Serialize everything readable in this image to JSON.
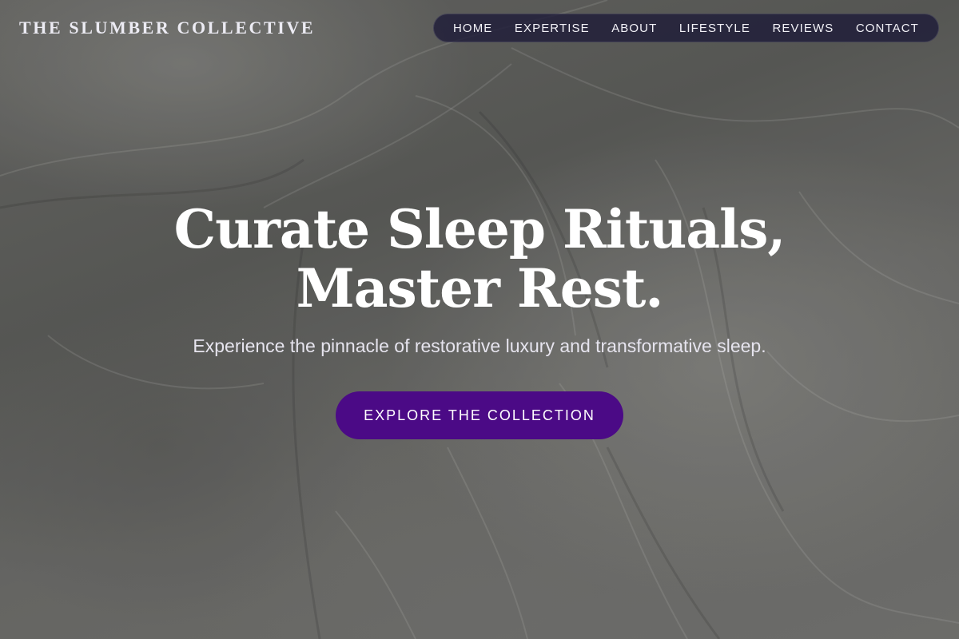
{
  "brand": {
    "name": "THE SLUMBER COLLECTIVE"
  },
  "nav": {
    "items": [
      {
        "label": "HOME"
      },
      {
        "label": "EXPERTISE"
      },
      {
        "label": "ABOUT"
      },
      {
        "label": "LIFESTYLE"
      },
      {
        "label": "REVIEWS"
      },
      {
        "label": "CONTACT"
      }
    ]
  },
  "hero": {
    "headline_line1": "Curate Sleep Rituals,",
    "headline_line2": "Master Rest.",
    "subheadline": "Experience the pinnacle of restorative luxury and transformative sleep.",
    "cta_label": "EXPLORE THE COLLECTION"
  },
  "colors": {
    "cta_background": "#4b0a86",
    "nav_background": "#1e1c38",
    "text_primary": "#ffffff"
  }
}
